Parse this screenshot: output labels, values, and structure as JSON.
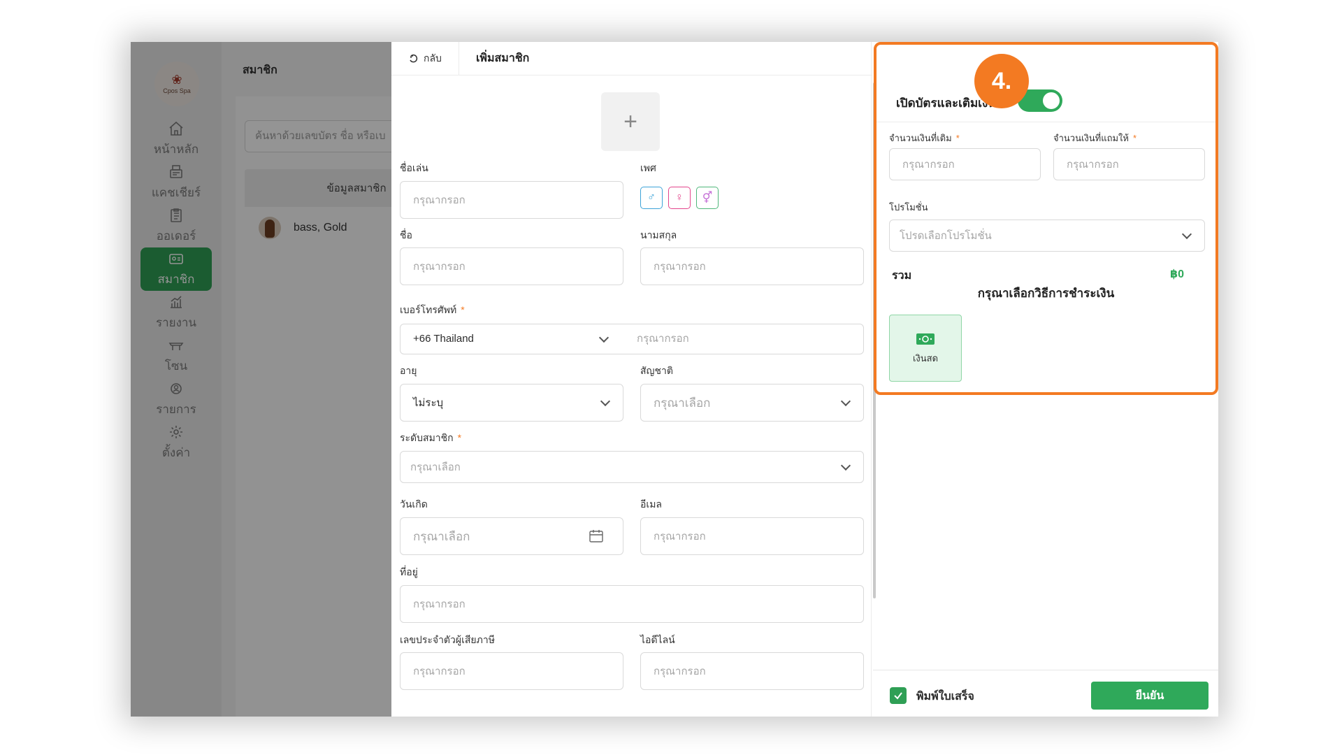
{
  "app": {
    "logo_text": "Cpos Spa"
  },
  "sidebar": {
    "items": [
      {
        "label": "หน้าหลัก",
        "icon": "home-icon"
      },
      {
        "label": "แคชเชียร์",
        "icon": "cashier-icon"
      },
      {
        "label": "ออเดอร์",
        "icon": "order-clipboard-icon"
      },
      {
        "label": "สมาชิก",
        "icon": "member-card-icon",
        "active": true
      },
      {
        "label": "รายงาน",
        "icon": "report-chart-icon"
      },
      {
        "label": "โซน",
        "icon": "spa-bed-icon"
      },
      {
        "label": "รายการ",
        "icon": "service-list-icon"
      },
      {
        "label": "ตั้งค่า",
        "icon": "settings-gear-icon"
      }
    ]
  },
  "members_page": {
    "title": "สมาชิก",
    "search_placeholder": "ค้นหาด้วยเลขบัตร ชื่อ หรือเบ",
    "table_header": "ข้อมูลสมาชิก",
    "rows": [
      {
        "name": "bass, Gold"
      }
    ]
  },
  "drawer": {
    "back_label": "กลับ",
    "title": "เพิ่มสมาชิก",
    "fields": {
      "nickname": {
        "label": "ชื่อเล่น",
        "placeholder": "กรุณากรอก"
      },
      "gender": {
        "label": "เพศ",
        "options": [
          "male-symbol",
          "female-symbol",
          "other-gender-symbol"
        ]
      },
      "first_name": {
        "label": "ชื่อ",
        "placeholder": "กรุณากรอก"
      },
      "last_name": {
        "label": "นามสกุล",
        "placeholder": "กรุณากรอก"
      },
      "phone": {
        "label": "เบอร์โทรศัพท์",
        "country_code": "+66 Thailand",
        "placeholder": "กรุณากรอก"
      },
      "age": {
        "label": "อายุ",
        "value": "ไม่ระบุ"
      },
      "nationality": {
        "label": "สัญชาติ",
        "placeholder": "กรุณาเลือก"
      },
      "member_level": {
        "label": "ระดับสมาชิก",
        "placeholder": "กรุณาเลือก"
      },
      "birthday": {
        "label": "วันเกิด",
        "placeholder": "กรุณาเลือก"
      },
      "email": {
        "label": "อีเมล",
        "placeholder": "กรุณากรอก"
      },
      "address": {
        "label": "ที่อยู่",
        "placeholder": "กรุณากรอก"
      },
      "tax_id": {
        "label": "เลขประจำตัวผู้เสียภาษี",
        "placeholder": "กรุณากรอก"
      },
      "line_id": {
        "label": "ไอดีไลน์",
        "placeholder": "กรุณากรอก"
      }
    },
    "required_mark": "*"
  },
  "card_panel": {
    "step_number": "4.",
    "toggle_label": "เปิดบัตรและเติมเงิน",
    "toggle_on": true,
    "topup_amount": {
      "label": "จำนวนเงินที่เติม",
      "placeholder": "กรุณากรอก"
    },
    "bonus_amount": {
      "label": "จำนวนเงินที่แถมให้",
      "placeholder": "กรุณากรอก"
    },
    "promotion": {
      "label": "โปรโมชั่น",
      "placeholder": "โปรดเลือกโปรโมชั่น"
    },
    "total_label": "รวม",
    "total_value": "฿0",
    "payment_prompt": "กรุณาเลือกวิธีการชำระเงิน",
    "payment_methods": [
      {
        "label": "เงินสด",
        "icon": "cash-banknote-icon"
      }
    ]
  },
  "footer": {
    "print_receipt_label": "พิมพ์ใบเสร็จ",
    "print_receipt_checked": true,
    "confirm_label": "ยืนยัน"
  },
  "colors": {
    "accent_green": "#2fa95a",
    "highlight_orange": "#f37a22"
  }
}
